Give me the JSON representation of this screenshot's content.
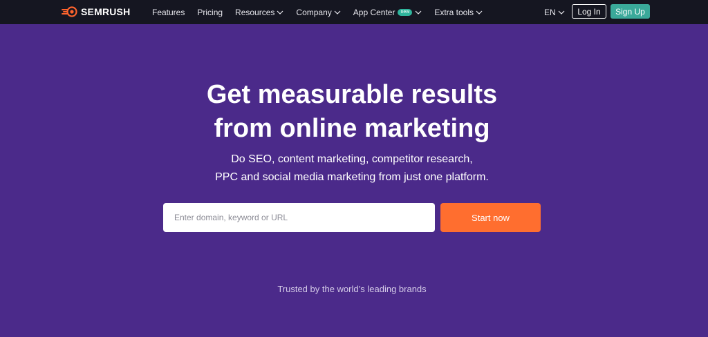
{
  "header": {
    "brand": "SEMRUSH",
    "nav": [
      {
        "label": "Features",
        "has_dropdown": false
      },
      {
        "label": "Pricing",
        "has_dropdown": false
      },
      {
        "label": "Resources",
        "has_dropdown": true
      },
      {
        "label": "Company",
        "has_dropdown": true
      },
      {
        "label": "App Center",
        "has_dropdown": true,
        "badge": "new"
      },
      {
        "label": "Extra tools",
        "has_dropdown": true
      }
    ],
    "language": "EN",
    "login_label": "Log In",
    "signup_label": "Sign Up"
  },
  "hero": {
    "headline_line1": "Get measurable results",
    "headline_line2": "from online marketing",
    "subhead_line1": "Do SEO, content marketing, competitor research,",
    "subhead_line2": "PPC and social media marketing from just one platform.",
    "search_placeholder": "Enter domain, keyword or URL",
    "search_value": "",
    "cta_label": "Start now",
    "trusted_text": "Trusted by the world’s leading brands"
  },
  "colors": {
    "topbar_bg": "#151621",
    "hero_bg": "#4b2a8a",
    "cta": "#ff6e2f",
    "signup": "#3aa99a",
    "badge": "#2fb59d",
    "logo_accent": "#ff642d"
  }
}
